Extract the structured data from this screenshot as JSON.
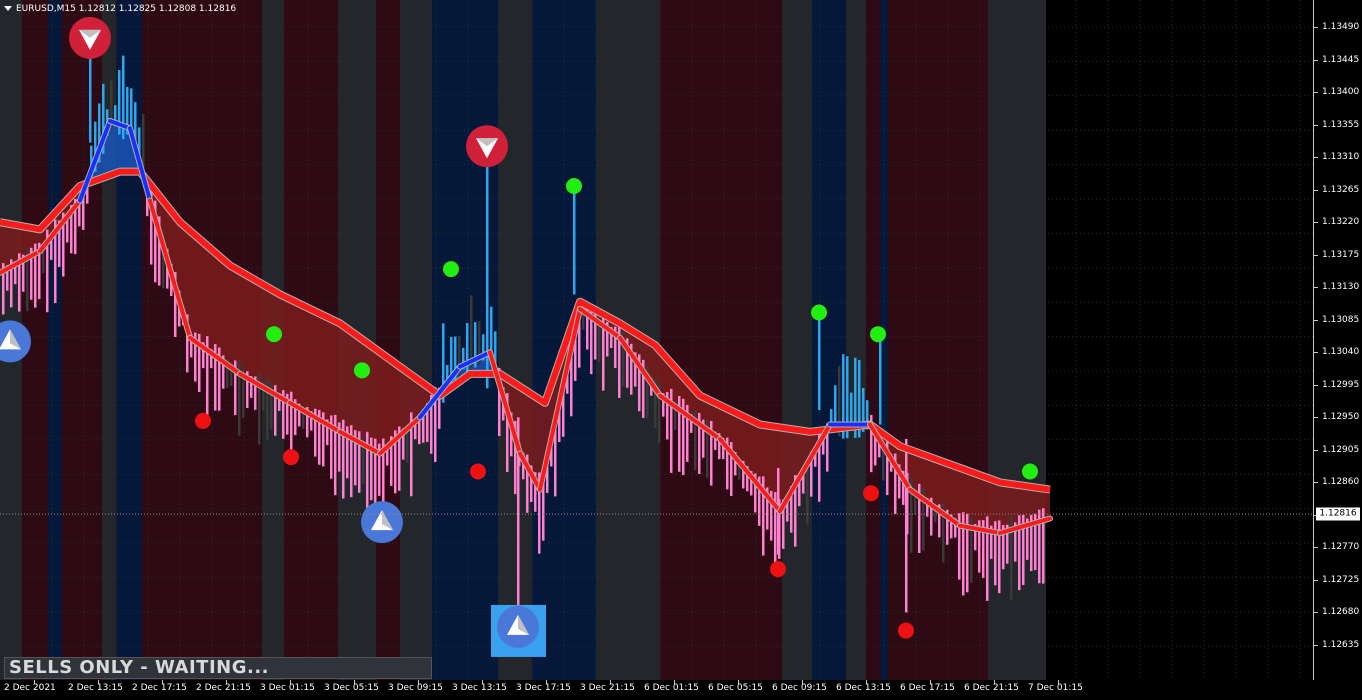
{
  "window": {
    "symbol_header": "EURUSD,M15  1.12812 1.12825 1.12808 1.12816",
    "current_price": "1.12816",
    "status_banner": "SELLS ONLY - WAITING..."
  },
  "colors": {
    "background": "#000000",
    "bear_zone": "#2e0a14",
    "bull_zone": "#061839",
    "neutral_zone": "#23272b",
    "band_red": "#ff1a1a",
    "band_blue": "#1530ff",
    "fill_red": "#7a1c1c",
    "fill_blue": "#1a55b8",
    "bar_pink": "#ff80d0",
    "bar_cyan": "#29a8f0",
    "bar_dark": "#3a3a3a",
    "dot_green": "#22ee11",
    "dot_red": "#ee1111",
    "sell_badge": "#d0203a",
    "buy_badge": "#4a78d8"
  },
  "chart_data": {
    "type": "candlestick",
    "symbol": "EURUSD",
    "timeframe": "M15",
    "ylim": [
      1.12615,
      1.13515
    ],
    "price_ticks": [
      "1.13490",
      "1.13445",
      "1.13400",
      "1.13355",
      "1.13310",
      "1.13265",
      "1.13220",
      "1.13175",
      "1.13130",
      "1.13085",
      "1.13040",
      "1.12995",
      "1.12950",
      "1.12905",
      "1.12860",
      "1.12815",
      "1.12770",
      "1.12725",
      "1.12680",
      "1.12635"
    ],
    "price_tick_values": [
      1.1349,
      1.13445,
      1.134,
      1.13355,
      1.1331,
      1.13265,
      1.1322,
      1.13175,
      1.1313,
      1.13085,
      1.1304,
      1.12995,
      1.1295,
      1.12905,
      1.1286,
      1.12815,
      1.1277,
      1.12725,
      1.1268,
      1.12635
    ],
    "time_labels": [
      "2 Dec 2021",
      "2 Dec 13:15",
      "2 Dec 17:15",
      "2 Dec 21:15",
      "3 Dec 01:15",
      "3 Dec 05:15",
      "3 Dec 09:15",
      "3 Dec 13:15",
      "3 Dec 17:15",
      "3 Dec 21:15",
      "6 Dec 01:15",
      "6 Dec 05:15",
      "6 Dec 09:15",
      "6 Dec 13:15",
      "6 Dec 17:15",
      "6 Dec 21:15",
      "7 Dec 01:15"
    ],
    "current_price": 1.12816,
    "upper_band": [
      [
        0,
        1.1322
      ],
      [
        40,
        1.1321
      ],
      [
        80,
        1.1327
      ],
      [
        120,
        1.1329
      ],
      [
        140,
        1.1329
      ],
      [
        180,
        1.1322
      ],
      [
        230,
        1.1316
      ],
      [
        280,
        1.1312
      ],
      [
        340,
        1.1308
      ],
      [
        400,
        1.1302
      ],
      [
        440,
        1.1298
      ],
      [
        470,
        1.1301
      ],
      [
        500,
        1.1301
      ],
      [
        545,
        1.1297
      ],
      [
        580,
        1.1311
      ],
      [
        620,
        1.1308
      ],
      [
        655,
        1.1305
      ],
      [
        700,
        1.1298
      ],
      [
        760,
        1.1294
      ],
      [
        810,
        1.1293
      ],
      [
        870,
        1.1294
      ],
      [
        900,
        1.1291
      ],
      [
        960,
        1.1288
      ],
      [
        1000,
        1.1286
      ],
      [
        1050,
        1.1285
      ]
    ],
    "lower_band": [
      [
        0,
        1.1315
      ],
      [
        40,
        1.1318
      ],
      [
        80,
        1.1325
      ],
      [
        110,
        1.1336
      ],
      [
        130,
        1.1335
      ],
      [
        150,
        1.1325
      ],
      [
        190,
        1.1306
      ],
      [
        240,
        1.1301
      ],
      [
        290,
        1.1297
      ],
      [
        340,
        1.1293
      ],
      [
        380,
        1.129
      ],
      [
        420,
        1.1295
      ],
      [
        460,
        1.1302
      ],
      [
        490,
        1.1304
      ],
      [
        520,
        1.129
      ],
      [
        540,
        1.1285
      ],
      [
        580,
        1.131
      ],
      [
        620,
        1.1306
      ],
      [
        660,
        1.1298
      ],
      [
        720,
        1.1292
      ],
      [
        780,
        1.1282
      ],
      [
        830,
        1.1294
      ],
      [
        870,
        1.1294
      ],
      [
        910,
        1.1285
      ],
      [
        960,
        1.128
      ],
      [
        1000,
        1.1279
      ],
      [
        1050,
        1.1281
      ]
    ],
    "signals": [
      {
        "type": "sell",
        "x": 90,
        "price": 1.13475
      },
      {
        "type": "sell",
        "x": 487,
        "price": 1.13325
      },
      {
        "type": "buy",
        "x": 10,
        "price": 1.13055
      },
      {
        "type": "buy",
        "x": 382,
        "price": 1.12805
      },
      {
        "type": "buy",
        "x": 518,
        "price": 1.1266
      }
    ],
    "dots": [
      {
        "color": "green",
        "x": 274,
        "price": 1.13065
      },
      {
        "color": "green",
        "x": 362,
        "price": 1.13015
      },
      {
        "color": "green",
        "x": 451,
        "price": 1.13155
      },
      {
        "color": "green",
        "x": 574,
        "price": 1.1327
      },
      {
        "color": "green",
        "x": 819,
        "price": 1.13095
      },
      {
        "color": "green",
        "x": 878,
        "price": 1.13065
      },
      {
        "color": "green",
        "x": 1030,
        "price": 1.12875
      },
      {
        "color": "red",
        "x": 203,
        "price": 1.12945
      },
      {
        "color": "red",
        "x": 291,
        "price": 1.12895
      },
      {
        "color": "red",
        "x": 478,
        "price": 1.12875
      },
      {
        "color": "red",
        "x": 778,
        "price": 1.1274
      },
      {
        "color": "red",
        "x": 871,
        "price": 1.12845
      },
      {
        "color": "red",
        "x": 906,
        "price": 1.12655
      }
    ]
  }
}
